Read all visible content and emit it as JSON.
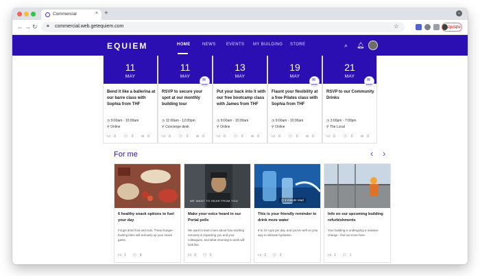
{
  "browser": {
    "tab_title": "Commercial",
    "tab_close": "×",
    "new_tab": "+",
    "url": "commercial.web.getequiem.com",
    "update_label": "Update",
    "update_dots": "⋮"
  },
  "site": {
    "logo": "EQUIEM",
    "nav": [
      "HOME",
      "NEWS",
      "EVENTS",
      "MY BUILDING",
      "STORE"
    ],
    "accent": "#2b0fb2"
  },
  "events": [
    {
      "day": "11",
      "month": "MAY",
      "rsvp": false,
      "title": "Bend it like a ballerina at our barre class with Sophia from THF",
      "time": "9:00am - 10:00am",
      "location": "Online",
      "likes": "0",
      "comments": "0",
      "shares": "0"
    },
    {
      "day": "11",
      "month": "MAY",
      "rsvp": true,
      "title": "RSVP to secure your spot at our monthly building tour",
      "time": "11:00am - 12:00pm",
      "location": "Concierge desk",
      "likes": "0",
      "comments": "0",
      "shares": "0"
    },
    {
      "day": "13",
      "month": "MAY",
      "rsvp": false,
      "title": "Put your back into it with our free bootcamp class with James from THF",
      "time": "9:00am - 10:00am",
      "location": "Online",
      "likes": "0",
      "comments": "0",
      "shares": "0"
    },
    {
      "day": "19",
      "month": "MAY",
      "rsvp": true,
      "title": "Flaunt your flexibility at a free Pilates class with Sophia from THF",
      "time": "9:00am - 10:00am",
      "location": "Online",
      "likes": "0",
      "comments": "0",
      "shares": "0"
    },
    {
      "day": "21",
      "month": "MAY",
      "rsvp": true,
      "title": "RSVP to our Community Drinks",
      "time": "3:00pm - 7:00pm",
      "location": "The Local",
      "likes": "0",
      "comments": "0",
      "shares": "0"
    }
  ],
  "rsvp_label": "RSVP",
  "for_me": {
    "title": "For me",
    "prev": "‹",
    "next": "›",
    "articles": [
      {
        "title": "6 healthy snack options to fuel your day",
        "excerpt": "Forget dried fruit and nuts. These hunger-busting bites will seriously up your snack game.",
        "likes": "1",
        "comments": "4"
      },
      {
        "title": "Make your voice heard in our Portal polls",
        "excerpt": "We want to learn more about how working remotely is impacting you and your colleagues, and what returning to work will look like.",
        "likes": "0",
        "comments": "0",
        "image_caption": "WE WANT TO HEAR FROM YOU"
      },
      {
        "title": "This is your friendly reminder to drink more water",
        "excerpt": "8 to 10 cups per day, and you've well on your way to ultimate hydration.",
        "likes": "2",
        "comments": "2",
        "read_time": "1 minute read"
      },
      {
        "title": "Info on our upcoming building refurbishments",
        "excerpt": "Your building is undergoing a massive change - find out more here.",
        "likes": "1",
        "comments": "1"
      }
    ]
  }
}
